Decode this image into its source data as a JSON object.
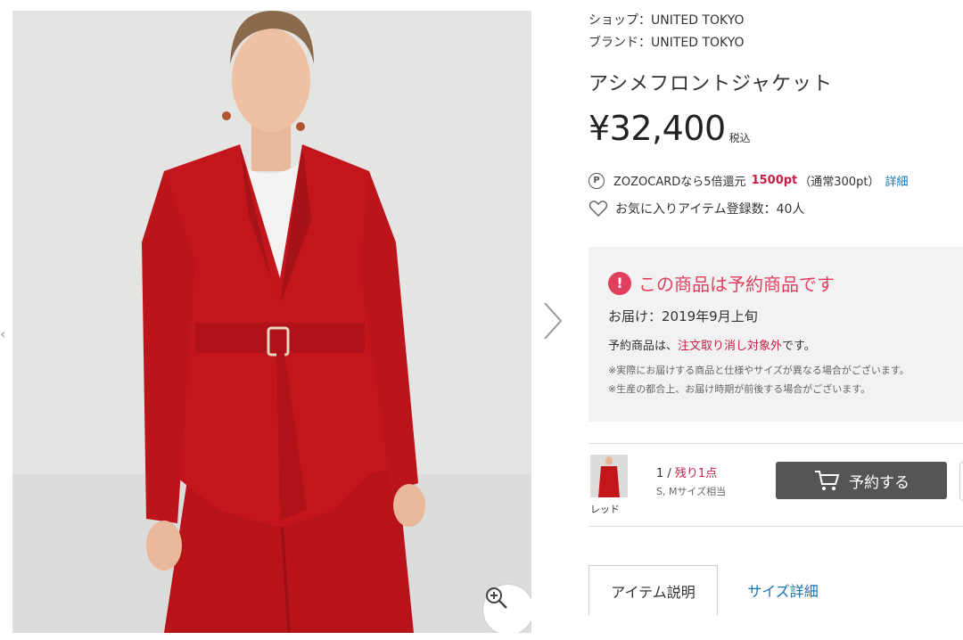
{
  "left_edge_glyph": "‹",
  "product": {
    "shop_label": "ショップ：",
    "shop": "UNITED TOKYO",
    "brand_label": "ブランド：",
    "brand": "UNITED TOKYO",
    "name": "アシメフロントジャケット",
    "price": "¥32,400",
    "tax_note": "税込"
  },
  "points": {
    "badge": "P",
    "text": "ZOZOCARDなら5倍還元",
    "value": "1500pt",
    "normal": "（通常300pt）",
    "detail_link": "詳細"
  },
  "favorites": {
    "text": "お気に入りアイテム登録数：40人"
  },
  "preorder": {
    "alert_glyph": "!",
    "title": "この商品は予約商品です",
    "delivery": "お届け：2019年9月上旬",
    "cancel_prefix": "予約商品は、",
    "cancel_highlight": "注文取り消し対象外",
    "cancel_suffix": "です。",
    "note1": "※実際にお届けする商品と仕様やサイズが異なる場合がございます。",
    "note2": "※生産の都合上、お届け時期が前後する場合がございます。"
  },
  "variant": {
    "color": "レッド",
    "stock_prefix": "1 / ",
    "stock_remaining": "残り1点",
    "size": "S, Mサイズ相当",
    "reserve_button": "予約する"
  },
  "tabs": [
    {
      "label": "アイテム説明",
      "active": true
    },
    {
      "label": "サイズ詳細",
      "active": false
    }
  ],
  "colors": {
    "accent_red": "#c81d43",
    "alert_pink": "#e0405e",
    "link_blue": "#1673b2",
    "button_gray": "#555555",
    "jacket_red": "#c3161c"
  },
  "icons": [
    "zoom-icon",
    "chevron-right-icon",
    "heart-icon",
    "cart-icon",
    "alert-icon",
    "point-badge-icon"
  ]
}
